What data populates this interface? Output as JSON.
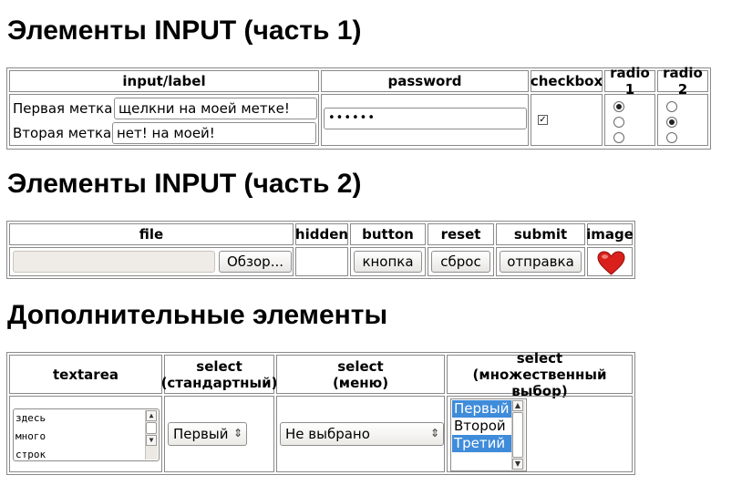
{
  "headings": {
    "part1": "Элементы INPUT (часть 1)",
    "part2": "Элементы INPUT (часть 2)",
    "extra": "Дополнительные элементы"
  },
  "table1": {
    "headers": [
      "input/label",
      "password",
      "checkbox",
      "radio 1",
      "radio 2"
    ],
    "label1": "Первая метка:",
    "input1": "щелкни на моей метке!",
    "label2": "Вторая метка:",
    "input2": "нет! на моей!",
    "password": "••••••",
    "checkbox_checked": true,
    "radio1_selected": 1,
    "radio2_selected": 2
  },
  "table2": {
    "headers": [
      "file",
      "hidden",
      "button",
      "reset",
      "submit",
      "image"
    ],
    "browse_label": "Обзор...",
    "button_label": "кнопка",
    "reset_label": "сброс",
    "submit_label": "отправка",
    "image_icon": "heart-icon",
    "image_color": "#d9201b"
  },
  "table3": {
    "headers": [
      "textarea",
      "select\n(стандартный)",
      "select\n(меню)",
      "select\n(множественный выбор)"
    ],
    "textarea_lines": [
      "здесь",
      "много",
      "строк"
    ],
    "select_standard": "Первый",
    "select_menu": "Не выбрано",
    "multi_options": [
      {
        "label": "Первый",
        "selected": true
      },
      {
        "label": "Второй",
        "selected": false
      },
      {
        "label": "Третий",
        "selected": true
      }
    ],
    "selection_color": "#3f8cda"
  }
}
